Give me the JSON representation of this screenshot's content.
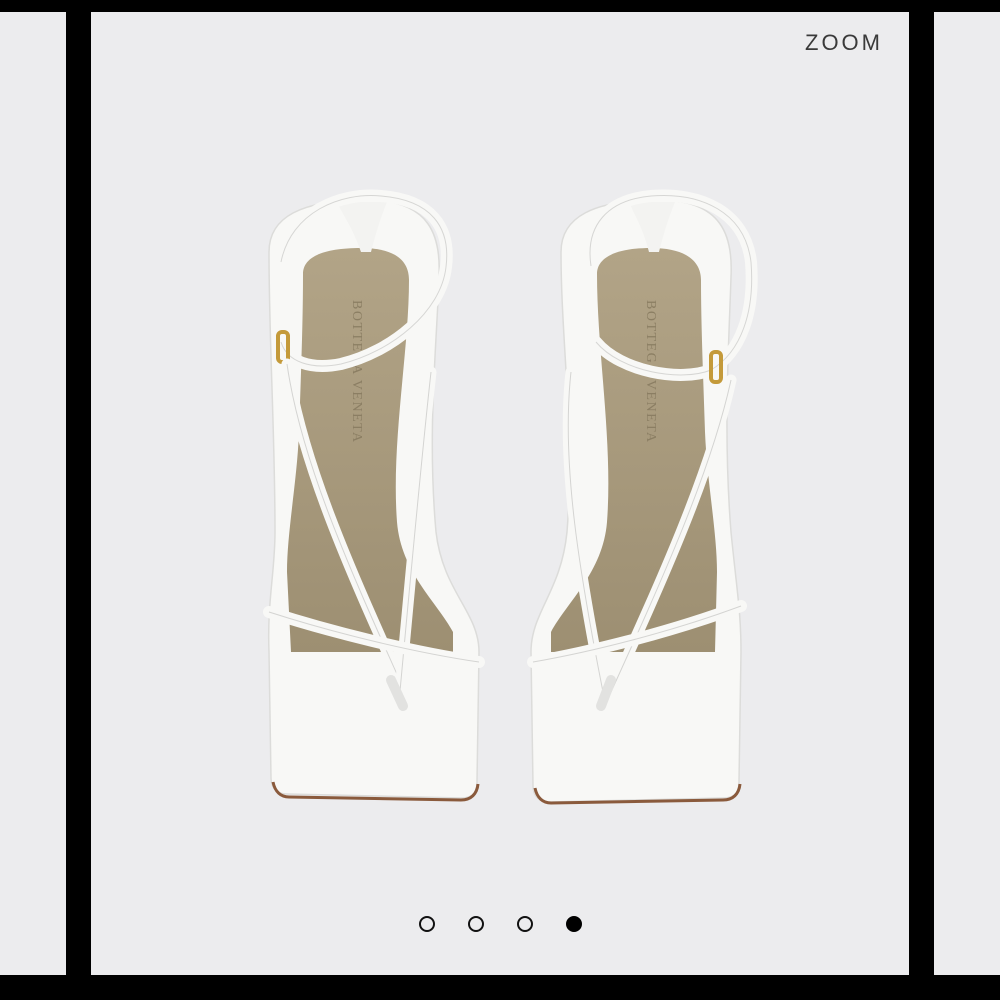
{
  "viewer": {
    "zoom_label": "ZOOM",
    "image_alt": "White strappy square-toe sandals, top view",
    "pages": [
      {
        "active": false
      },
      {
        "active": false
      },
      {
        "active": false
      },
      {
        "active": true
      }
    ]
  },
  "product": {
    "insole_brand": "BOTTEGA VENETA",
    "colors": {
      "background": "#ececee",
      "leather": "#f8f8f6",
      "insole": "#a79a7e",
      "sole_edge": "#8a5a3c",
      "buckle": "#c49a3a"
    }
  }
}
